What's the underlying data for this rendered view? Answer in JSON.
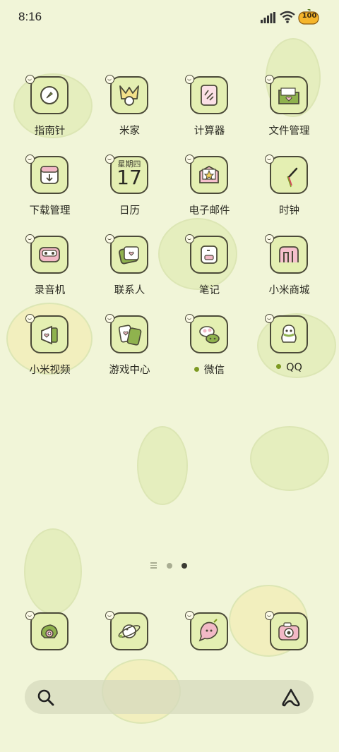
{
  "status_bar": {
    "time": "8:16",
    "battery_level": "100",
    "icons": [
      "cellular-signal-icon",
      "wifi-icon",
      "battery-icon"
    ]
  },
  "apps": [
    {
      "label": "指南针",
      "icon": "compass-icon",
      "badge_dot": false
    },
    {
      "label": "米家",
      "icon": "mijia-icon",
      "badge_dot": false
    },
    {
      "label": "计算器",
      "icon": "calculator-icon",
      "badge_dot": false
    },
    {
      "label": "文件管理",
      "icon": "folder-icon",
      "badge_dot": false
    },
    {
      "label": "下载管理",
      "icon": "download-icon",
      "badge_dot": false
    },
    {
      "label": "日历",
      "icon": "calendar-icon",
      "badge_dot": false,
      "weekday": "星期四",
      "day": "17"
    },
    {
      "label": "电子邮件",
      "icon": "mail-icon",
      "badge_dot": false
    },
    {
      "label": "时钟",
      "icon": "clock-icon",
      "badge_dot": false
    },
    {
      "label": "录音机",
      "icon": "recorder-icon",
      "badge_dot": false
    },
    {
      "label": "联系人",
      "icon": "contacts-icon",
      "badge_dot": false
    },
    {
      "label": "笔记",
      "icon": "notes-icon",
      "badge_dot": false
    },
    {
      "label": "小米商城",
      "icon": "mi-store-icon",
      "badge_dot": false
    },
    {
      "label": "小米视频",
      "icon": "video-icon",
      "badge_dot": false
    },
    {
      "label": "游戏中心",
      "icon": "game-center-icon",
      "badge_dot": false
    },
    {
      "label": "微信",
      "icon": "wechat-icon",
      "badge_dot": true
    },
    {
      "label": "QQ",
      "icon": "qq-penguin-icon",
      "badge_dot": true
    }
  ],
  "pager": {
    "pages": 2,
    "active_page": 2,
    "colors": {
      "inactive": "#a9ad92",
      "active": "#3b3b33"
    }
  },
  "dock": [
    {
      "name": "phone",
      "icon": "phone-icon"
    },
    {
      "name": "browser",
      "icon": "browser-planet-icon"
    },
    {
      "name": "messages",
      "icon": "message-icon"
    },
    {
      "name": "camera",
      "icon": "camera-icon"
    }
  ],
  "search_bar": {
    "left_icon": "search-icon",
    "right_icon": "assistant-icon"
  },
  "theme": {
    "background": "#f1f5d8",
    "tile": "#e4efb2",
    "outline": "#4b4a38",
    "accent_pink": "#f2b9c6",
    "dot_green": "#7d9a22"
  }
}
